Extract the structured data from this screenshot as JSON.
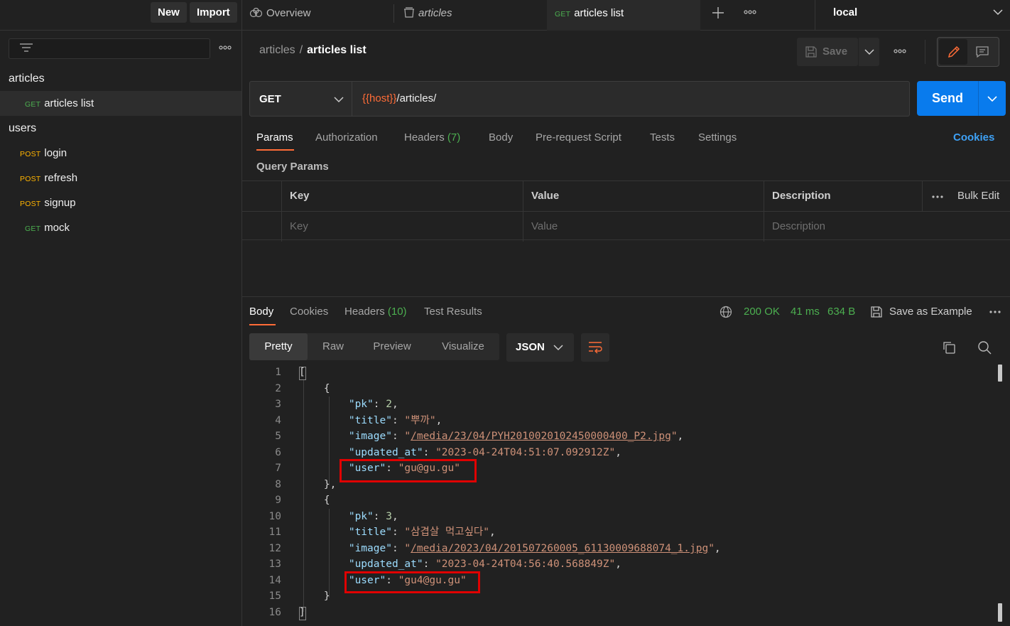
{
  "sidebar": {
    "new_label": "New",
    "import_label": "Import",
    "items": [
      {
        "type": "folder",
        "label": "articles"
      },
      {
        "type": "request",
        "method": "GET",
        "label": "articles list",
        "active": true
      },
      {
        "type": "folder",
        "label": "users"
      },
      {
        "type": "request",
        "method": "POST",
        "label": "login"
      },
      {
        "type": "request",
        "method": "POST",
        "label": "refresh"
      },
      {
        "type": "request",
        "method": "POST",
        "label": "signup"
      },
      {
        "type": "request",
        "method": "GET",
        "label": "mock"
      }
    ]
  },
  "tabs": {
    "overview": "Overview",
    "articles": "articles",
    "active_method": "GET",
    "active_label": "articles list"
  },
  "environment": "local",
  "request": {
    "breadcrumb_parent": "articles",
    "breadcrumb_sep": "/",
    "breadcrumb_current": "articles list",
    "save_label": "Save",
    "method": "GET",
    "url_var": "{{host}}",
    "url_path": "/articles/",
    "send_label": "Send",
    "tabs": {
      "params": "Params",
      "authorization": "Authorization",
      "headers": "Headers",
      "headers_count": "(7)",
      "body": "Body",
      "prerequest": "Pre-request Script",
      "tests": "Tests",
      "settings": "Settings"
    },
    "cookies_label": "Cookies",
    "query_params_title": "Query Params",
    "table": {
      "columns": [
        "Key",
        "Value",
        "Description"
      ],
      "placeholders": [
        "Key",
        "Value",
        "Description"
      ],
      "bulk_edit": "Bulk Edit"
    }
  },
  "response": {
    "tabs": {
      "body": "Body",
      "cookies": "Cookies",
      "headers": "Headers",
      "headers_count": "(10)",
      "test_results": "Test Results"
    },
    "status": "200 OK",
    "time": "41 ms",
    "size": "634 B",
    "save_example": "Save as Example",
    "formats": [
      "Pretty",
      "Raw",
      "Preview",
      "Visualize"
    ],
    "language": "JSON",
    "line_numbers": [
      "1",
      "2",
      "3",
      "4",
      "5",
      "6",
      "7",
      "8",
      "9",
      "10",
      "11",
      "12",
      "13",
      "14",
      "15",
      "16"
    ],
    "articles": [
      {
        "pk": "2",
        "title": "\"뿌까\"",
        "image": "/media/23/04/PYH2010020102450000400_P2.jpg",
        "updated_at": "\"2023-04-24T04:51:07.092912Z\"",
        "user": "\"gu@gu.gu\""
      },
      {
        "pk": "3",
        "title": "\"삼겹살 먹고싶다\"",
        "image": "/media/2023/04/201507260005_61130009688074_1.jpg",
        "updated_at": "\"2023-04-24T04:56:40.568849Z\"",
        "user": "\"gu4@gu.gu\""
      }
    ]
  },
  "colors": {
    "accent": "#ff6c37",
    "send": "#097bed",
    "get": "#4caf50",
    "post": "#ffb400",
    "highlight": "#e00000"
  }
}
